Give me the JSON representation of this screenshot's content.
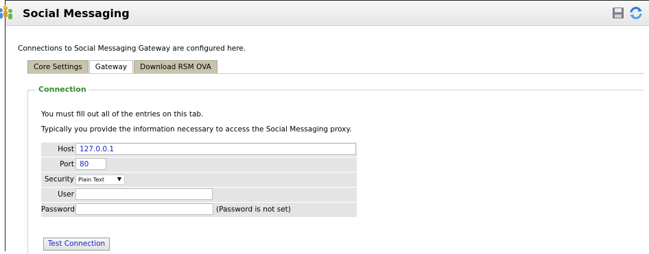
{
  "page": {
    "title": "Social Messaging",
    "intro": "Connections to Social Messaging Gateway are configured here."
  },
  "tabs": [
    {
      "label": "Core Settings",
      "active": false
    },
    {
      "label": "Gateway",
      "active": true
    },
    {
      "label": "Download RSM OVA",
      "active": false
    }
  ],
  "connection": {
    "legend": "Connection",
    "note1": "You must fill out all of the entries on this tab.",
    "note2": "Typically you provide the information necessary to access the Social Messaging proxy.",
    "host": {
      "label": "Host",
      "value": "127.0.0.1"
    },
    "port": {
      "label": "Port",
      "value": "80"
    },
    "security": {
      "label": "Security",
      "value": "Plain Text"
    },
    "user": {
      "label": "User",
      "value": ""
    },
    "password": {
      "label": "Password",
      "value": "",
      "status": "(Password is not set)"
    },
    "test_button": "Test Connection"
  },
  "icons": {
    "logo": "people-star-icon",
    "save": "save-icon",
    "refresh": "refresh-icon"
  },
  "colors": {
    "legend": "#2e8b2e",
    "value_text": "#1a22c8",
    "tab_inactive": "#c9c4ad",
    "row_bg": "#e4e4e4"
  }
}
